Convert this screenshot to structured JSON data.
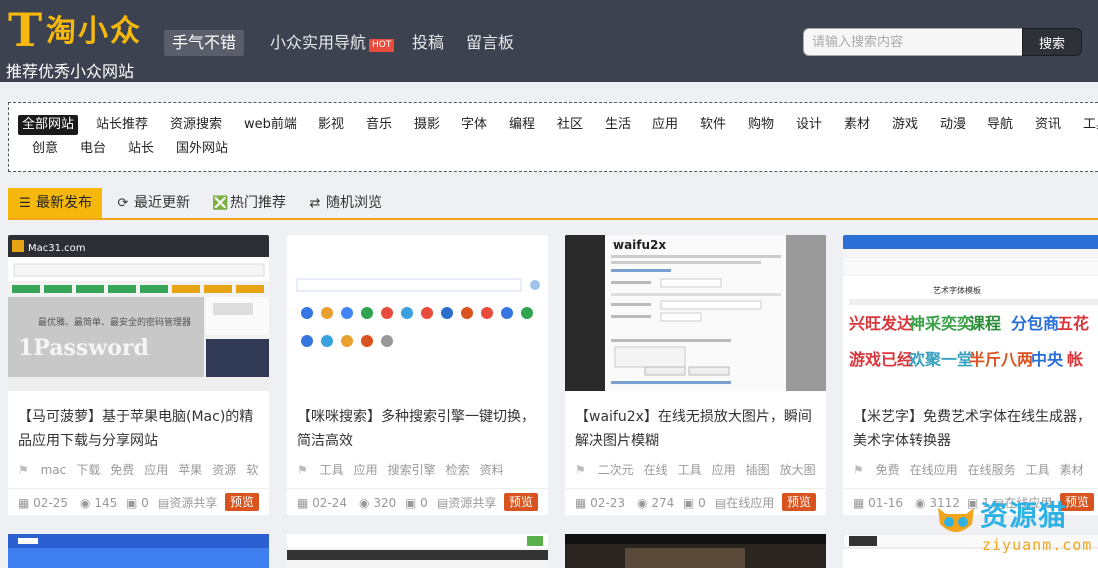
{
  "header": {
    "logo_mark": "T",
    "brand": "淘小众",
    "tagline": "推荐优秀小众网站",
    "nav": [
      {
        "label": "手气不错",
        "active": true
      },
      {
        "label": "小众实用导航",
        "badge": "HOT"
      },
      {
        "label": "投稿"
      },
      {
        "label": "留言板"
      }
    ],
    "search": {
      "placeholder": "请输入搜索内容",
      "button": "搜索"
    }
  },
  "categories": {
    "row1": [
      "全部网站",
      "站长推荐",
      "资源搜索",
      "web前端",
      "影视",
      "音乐",
      "摄影",
      "字体",
      "编程",
      "社区",
      "生活",
      "应用",
      "软件",
      "购物",
      "设计",
      "素材",
      "游戏",
      "动漫",
      "导航",
      "资讯",
      "工具"
    ],
    "row2": [
      "创意",
      "电台",
      "站长",
      "国外网站"
    ],
    "active": "全部网站"
  },
  "tabs": [
    {
      "label": "最新发布",
      "icon": "list-icon",
      "active": true
    },
    {
      "label": "最近更新",
      "icon": "refresh-icon"
    },
    {
      "label": "热门推荐",
      "icon": "fire-icon"
    },
    {
      "label": "随机浏览",
      "icon": "shuffle-icon"
    }
  ],
  "cards": [
    {
      "title": "【马可菠萝】基于苹果电脑(Mac)的精品应用下载与分享网站",
      "tags": [
        "mac",
        "下载",
        "免费",
        "应用",
        "苹果",
        "资源",
        "软"
      ],
      "date": "02-25",
      "views": "145",
      "comments": "0",
      "category": "资源共享",
      "preview": "预览",
      "thumb_text": "Mac31.com",
      "thumb_banner": "1Password",
      "thumb_slogan": "最优雅、最简单、最安全的密码管理器"
    },
    {
      "title": "【咪咪搜索】多种搜索引擎一键切换，简洁高效",
      "tags": [
        "工具",
        "应用",
        "搜索引擎",
        "检索",
        "资料"
      ],
      "date": "02-24",
      "views": "320",
      "comments": "0",
      "category": "资源共享",
      "preview": "预览"
    },
    {
      "title": "【waifu2x】在线无损放大图片，瞬间解决图片模糊",
      "tags": [
        "二次元",
        "在线",
        "工具",
        "应用",
        "插图",
        "放大图"
      ],
      "date": "02-23",
      "views": "274",
      "comments": "0",
      "category": "在线应用",
      "preview": "预览",
      "thumb_text": "waifu2x"
    },
    {
      "title": "【米艺字】免费艺术字体在线生成器，美术字体转换器",
      "tags": [
        "免费",
        "在线应用",
        "在线服务",
        "工具",
        "素材"
      ],
      "date": "01-16",
      "views": "3112",
      "comments": "1",
      "category": "在线应用",
      "preview": "预览",
      "thumb_text": "艺术字体模板"
    }
  ],
  "watermark": {
    "main": "资源猫",
    "sub": "ziyuanm.com"
  },
  "colors": {
    "header_bg": "#3d4250",
    "accent": "#f6b80d",
    "preview": "#d9531e"
  }
}
